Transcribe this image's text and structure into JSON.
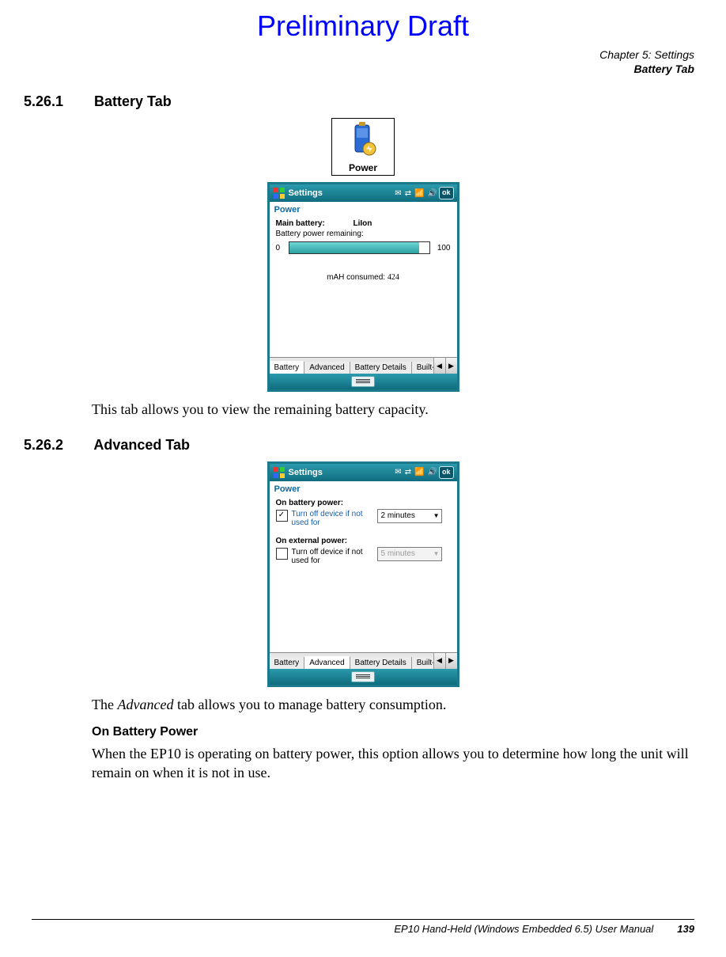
{
  "draft_banner": "Preliminary Draft",
  "header": {
    "chapter": "Chapter 5:  Settings",
    "section": "Battery Tab"
  },
  "sec1": {
    "number": "5.26.1",
    "title": "Battery Tab",
    "icon_label": "Power",
    "shot": {
      "title": "Settings",
      "ok": "ok",
      "subtitle": "Power",
      "main_batt_key": "Main battery:",
      "main_batt_val": "LiIon",
      "remaining_label": "Battery power remaining:",
      "p0": "0",
      "p100": "100",
      "mah_label": "mAH consumed:",
      "mah_value": "424",
      "tabs": [
        "Battery",
        "Advanced",
        "Battery Details",
        "Built-I"
      ]
    },
    "body": "This tab allows you to view the remaining battery capacity."
  },
  "sec2": {
    "number": "5.26.2",
    "title": "Advanced Tab",
    "shot": {
      "title": "Settings",
      "ok": "ok",
      "subtitle": "Power",
      "group1_title": "On battery power:",
      "group1_text": "Turn off device if not used for",
      "group1_value": "2 minutes",
      "group2_title": "On external power:",
      "group2_text": "Turn off device if not used for",
      "group2_value": "5 minutes",
      "tabs": [
        "Battery",
        "Advanced",
        "Battery Details",
        "Built-I"
      ]
    },
    "body": "The Advanced tab allows you to manage battery consumption.",
    "body_em": "Advanced",
    "sub_heading": "On Battery Power",
    "sub_body": "When the EP10 is operating on battery power, this option allows you to determine how long the unit will remain on when it is not in use."
  },
  "footer": {
    "manual": "EP10 Hand-Held (Windows Embedded 6.5) User Manual",
    "page": "139"
  }
}
